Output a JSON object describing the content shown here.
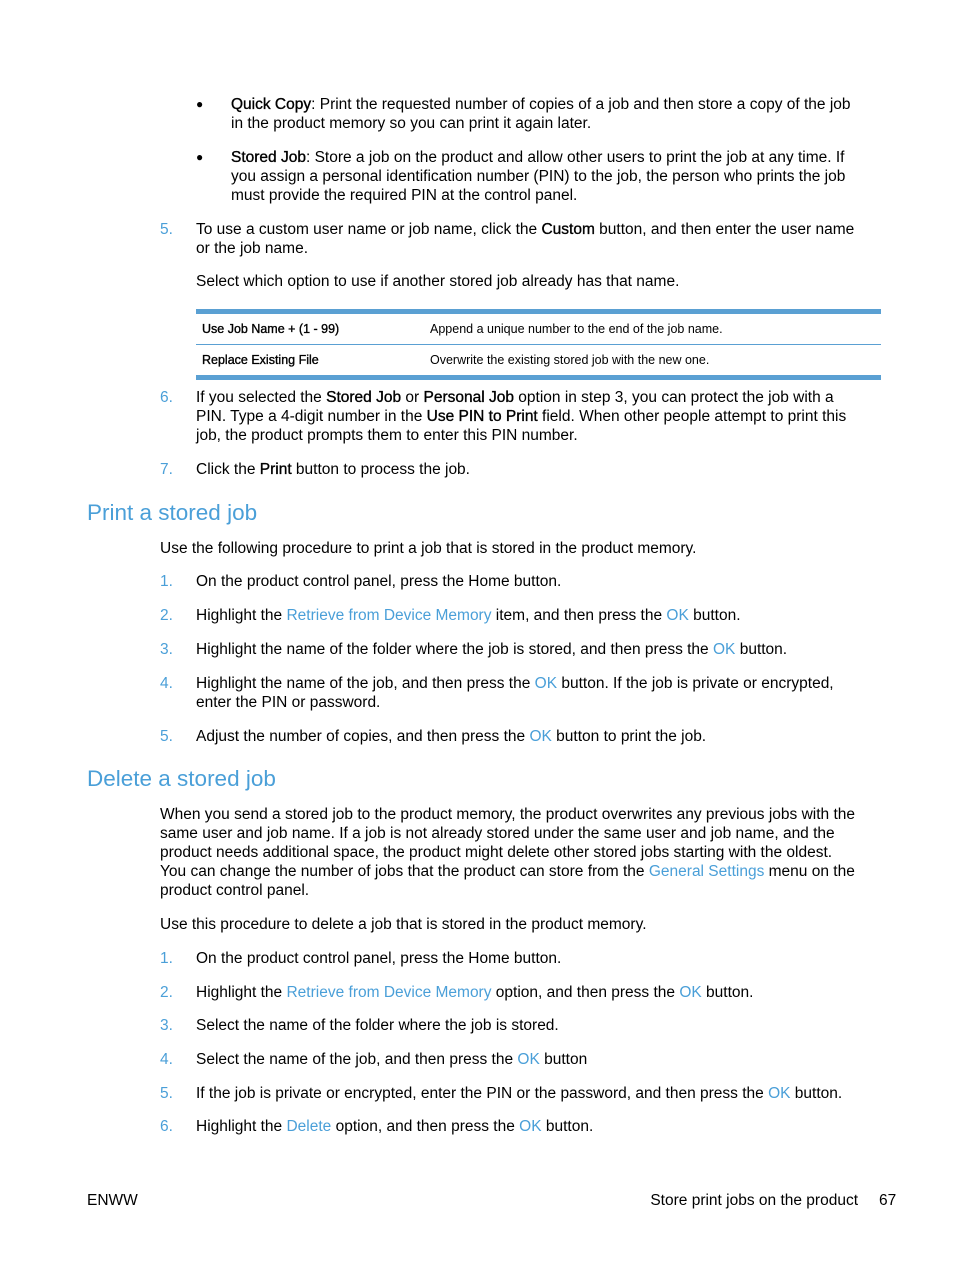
{
  "top_bullets": [
    {
      "term": "Quick Copy",
      "lines": [
        ": Print the requested number of copies of a job and then store a copy of the job",
        "in the product memory so you can print it again later."
      ]
    },
    {
      "term": "Stored Job",
      "lines": [
        ": Store a job on the product and allow other users to print the job at any time. If",
        "you assign a personal identification number (PIN) to the job, the person who prints the job",
        "must provide the required PIN at the control panel."
      ]
    }
  ],
  "step5": {
    "num": "5.",
    "pre": "To use a custom user name or job name, click the ",
    "bold": "Custom",
    "post": " button, and then enter the user name",
    "line2": "or the job name.",
    "note": "Select which option to use if another stored job already has that name."
  },
  "table": {
    "rows": [
      {
        "option": "Use Job Name + (1 - 99)",
        "description": "Append a unique number to the end of the job name."
      },
      {
        "option": "Replace Existing File",
        "description": "Overwrite the existing stored job with the new one."
      }
    ]
  },
  "step6": {
    "num": "6.",
    "l1_a": "If you selected the ",
    "l1_b1": "Stored Job",
    "l1_c": " or ",
    "l1_b2": "Personal Job",
    "l1_d": " option in step 3, you can protect the job with a",
    "l2_a": "PIN. Type a 4-digit number in the ",
    "l2_b": "Use PIN to Print",
    "l2_c": " field. When other people attempt to print this",
    "l3": "job, the product prompts them to enter this PIN number."
  },
  "step7": {
    "num": "7.",
    "pre": "Click the ",
    "bold": "Print",
    "post": " button to process the job."
  },
  "print_section": {
    "heading": "Print a stored job",
    "intro": "Use the following procedure to print a job that is stored in the product memory.",
    "steps": [
      {
        "num": "1.",
        "a": "On the product control panel, press the Home button."
      },
      {
        "num": "2.",
        "a": "Highlight the ",
        "link1": "Retrieve from Device Memory",
        "b": " item, and then press the ",
        "link2": "OK",
        "c": " button."
      },
      {
        "num": "3.",
        "a": "Highlight the name of the folder where the job is stored, and then press the ",
        "link1": "OK",
        "b": " button."
      },
      {
        "num": "4.",
        "a": "Highlight the name of the job, and then press the ",
        "link1": "OK",
        "b": " button. If the job is private or encrypted,",
        "line2": "enter the PIN or password."
      },
      {
        "num": "5.",
        "a": "Adjust the number of copies, and then press the ",
        "link1": "OK",
        "b": " button to print the job."
      }
    ]
  },
  "delete_section": {
    "heading": "Delete a stored job",
    "para_lines": [
      "When you send a stored job to the product memory, the product overwrites any previous jobs with the",
      "same user and job name. If a job is not already stored under the same user and job name, and the",
      "product needs additional space, the product might delete other stored jobs starting with the oldest."
    ],
    "para_l4_a": "You can change the number of jobs that the product can store from the ",
    "para_l4_link": "General Settings",
    "para_l4_b": " menu on the",
    "para_l5": "product control panel.",
    "intro": "Use this procedure to delete a job that is stored in the product memory.",
    "steps": [
      {
        "num": "1.",
        "a": "On the product control panel, press the Home button."
      },
      {
        "num": "2.",
        "a": "Highlight the ",
        "link1": "Retrieve from Device Memory",
        "b": " option, and then press the ",
        "link2": "OK",
        "c": " button."
      },
      {
        "num": "3.",
        "a": "Select the name of the folder where the job is stored."
      },
      {
        "num": "4.",
        "a": "Select the name of the job, and then press the ",
        "link1": "OK",
        "b": " button"
      },
      {
        "num": "5.",
        "a": "If the job is private or encrypted, enter the PIN or the password, and then press the ",
        "link1": "OK",
        "b": " button."
      },
      {
        "num": "6.",
        "a": "Highlight the ",
        "link1": "Delete",
        "b": " option, and then press the ",
        "link2": "OK",
        "c": " button."
      }
    ]
  },
  "footer": {
    "left": "ENWW",
    "section": "Store print jobs on the product",
    "page": "67"
  }
}
